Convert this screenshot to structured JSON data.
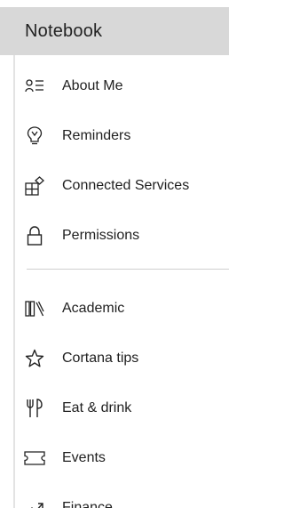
{
  "header": {
    "title": "Notebook"
  },
  "menu": {
    "top_items": [
      {
        "label": "About Me",
        "icon": "person-list-icon"
      },
      {
        "label": "Reminders",
        "icon": "lightbulb-icon"
      },
      {
        "label": "Connected Services",
        "icon": "connected-services-icon"
      },
      {
        "label": "Permissions",
        "icon": "lock-icon"
      }
    ],
    "bottom_items": [
      {
        "label": "Academic",
        "icon": "books-icon"
      },
      {
        "label": "Cortana tips",
        "icon": "star-icon"
      },
      {
        "label": "Eat & drink",
        "icon": "fork-knife-icon"
      },
      {
        "label": "Events",
        "icon": "ticket-icon"
      },
      {
        "label": "Finance",
        "icon": "trending-chart-icon"
      }
    ]
  },
  "colors": {
    "header_background": "#d8d8d8",
    "text": "#1f1f1f",
    "divider": "#cfcfcf"
  }
}
